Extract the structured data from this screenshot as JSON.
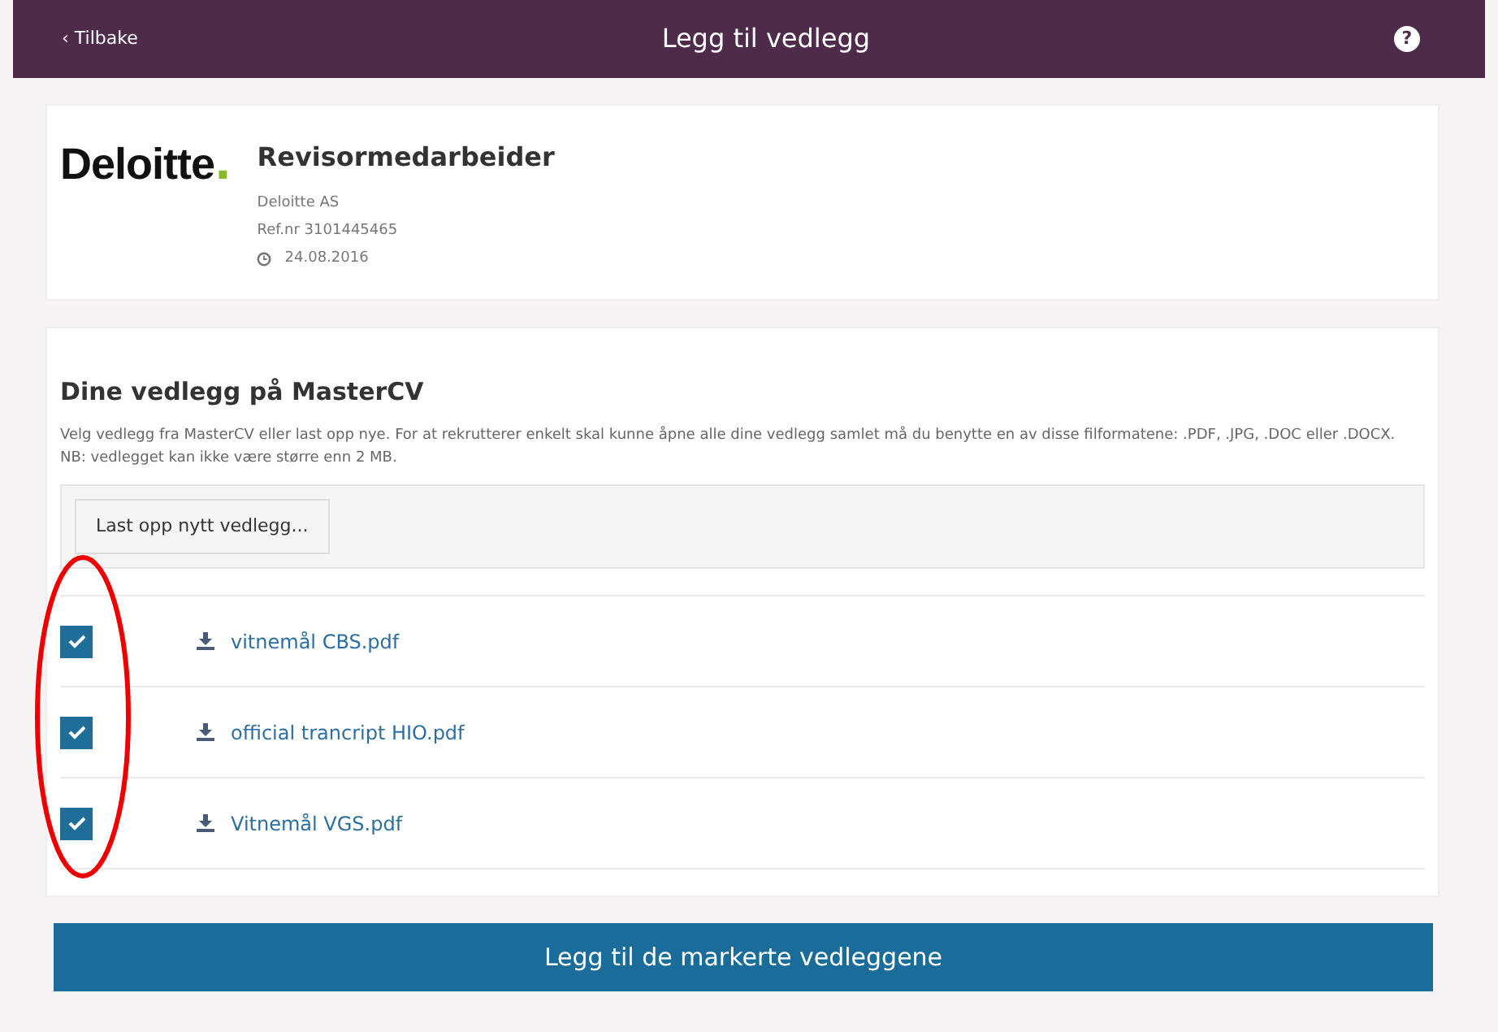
{
  "header": {
    "back": "‹ Tilbake",
    "title": "Legg til vedlegg",
    "help": "?"
  },
  "job": {
    "logo": "Deloitte",
    "logo_dot": ".",
    "title": "Revisormedarbeider",
    "company": "Deloitte AS",
    "ref": "Ref.nr 3101445465",
    "date": "24.08.2016"
  },
  "attachments": {
    "heading": "Dine vedlegg på MasterCV",
    "description": "Velg vedlegg fra MasterCV eller last opp nye. For at rekrutterer enkelt skal kunne åpne alle dine vedlegg samlet må du benytte en av disse filformatene: .PDF, .JPG, .DOC eller .DOCX. NB: vedlegget kan ikke være større enn 2 MB.",
    "upload": "Last opp nytt vedlegg...",
    "files": [
      {
        "name": "vitnemål CBS.pdf",
        "checked": true
      },
      {
        "name": "official trancript HIO.pdf",
        "checked": true
      },
      {
        "name": "Vitnemål VGS.pdf",
        "checked": true
      }
    ]
  },
  "submit": "Legg til de markerte vedleggene"
}
